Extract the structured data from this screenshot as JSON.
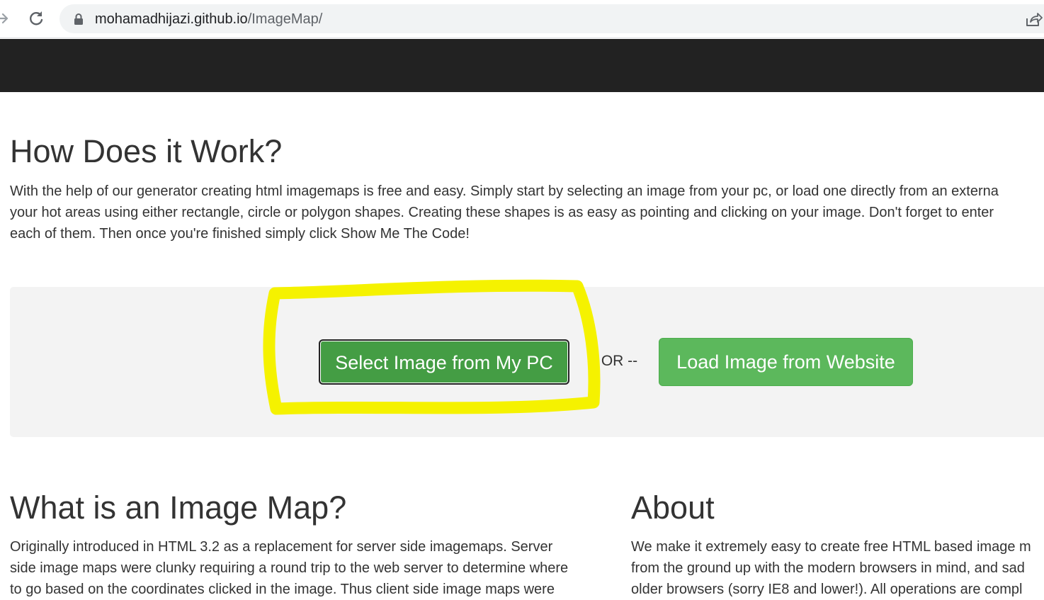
{
  "browser": {
    "url_host": "mohamadhijazi.github.io",
    "url_path": "/ImageMap/",
    "icons": [
      "forward-arrow-icon",
      "reload-icon",
      "lock-icon",
      "share-icon"
    ]
  },
  "how": {
    "title": "How Does it Work?",
    "lines": [
      "With the help of our generator creating html imagemaps is free and easy. Simply start by selecting an image from your pc, or load one directly from an externa",
      "your hot areas using either rectangle, circle or polygon shapes. Creating these shapes is as easy as pointing and clicking on your image. Don't forget to enter",
      "each of them. Then once you're finished simply click Show Me The Code!"
    ]
  },
  "actions": {
    "select_label": "Select Image from My PC",
    "or_label": "-- OR --",
    "load_label": "Load Image from Website"
  },
  "image_map": {
    "title": "What is an Image Map?",
    "lines": [
      "Originally introduced in HTML 3.2 as a replacement for server side imagemaps. Server",
      "side image maps were clunky requiring a round trip to the web server to determine where",
      "to go based on the coordinates clicked in the image. Thus client side image maps were"
    ]
  },
  "about": {
    "title": "About",
    "lines": [
      "We make it extremely easy to create free HTML based image m",
      "from the ground up with the modern browsers in mind, and sad",
      "older browsers (sorry IE8 and lower!). All operations are compl"
    ]
  },
  "colors": {
    "navbar": "#222222",
    "well": "#f3f3f3",
    "btn_select": "#449d44",
    "btn_load": "#5cb85c",
    "highlight": "#f5f200"
  }
}
